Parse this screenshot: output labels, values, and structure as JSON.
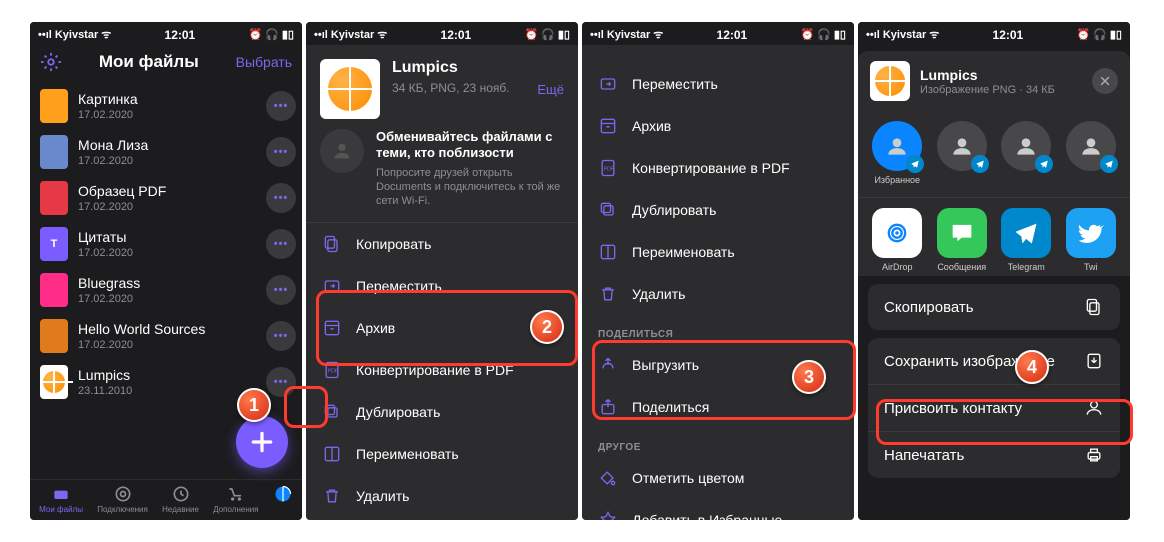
{
  "status": {
    "carrier": "Kyivstar",
    "time": "12:01"
  },
  "screen1": {
    "title": "Мои файлы",
    "select": "Выбрать",
    "files": [
      {
        "name": "Картинка",
        "date": "17.02.2020",
        "color": "#ff9f1c",
        "t": ""
      },
      {
        "name": "Мона Лиза",
        "date": "17.02.2020",
        "color": "#6a89cc",
        "t": ""
      },
      {
        "name": "Образец PDF",
        "date": "17.02.2020",
        "color": "#e63946",
        "t": ""
      },
      {
        "name": "Цитаты",
        "date": "17.02.2020",
        "color": "#7b5cff",
        "t": "T"
      },
      {
        "name": "Bluegrass",
        "date": "17.02.2020",
        "color": "#ff2d87",
        "t": ""
      },
      {
        "name": "Hello World Sources",
        "date": "17.02.2020",
        "color": "#e07a1a",
        "t": ""
      },
      {
        "name": "Lumpics",
        "date": "23.11.2010",
        "color": "#ffffff",
        "t": ""
      }
    ],
    "tabs": [
      "Мои файлы",
      "Подключения",
      "Недавние",
      "Дополнения",
      ""
    ]
  },
  "screen2": {
    "file_name": "Lumpics",
    "file_meta": "34 КБ, PNG, 23 нояб.",
    "more": "Ещё",
    "nearby_title": "Обменивайтесь файлами с теми, кто поблизости",
    "nearby_sub": "Попросите друзей открыть Documents и подключитесь к той же сети Wi-Fi.",
    "actions": [
      "Копировать",
      "Переместить",
      "Архив",
      "Конвертирование в PDF",
      "Дублировать",
      "Переименовать",
      "Удалить"
    ]
  },
  "screen3": {
    "actions_top": [
      "Переместить",
      "Архив",
      "Конвертирование в PDF",
      "Дублировать",
      "Переименовать",
      "Удалить"
    ],
    "share_header": "ПОДЕЛИТЬСЯ",
    "share_actions": [
      "Выгрузить",
      "Поделиться"
    ],
    "other_header": "ДРУГОЕ",
    "other_actions": [
      "Отметить цветом",
      "Добавить в Избранные"
    ]
  },
  "screen4": {
    "file_name": "Lumpics",
    "file_meta": "Изображение PNG · 34 КБ",
    "contacts": [
      "Избранное",
      "",
      "",
      ""
    ],
    "apps": [
      "AirDrop",
      "Сообщения",
      "Telegram",
      "Twi"
    ],
    "actions": [
      "Скопировать",
      "Сохранить изображение",
      "Присвоить контакту",
      "Напечатать"
    ]
  },
  "badges": [
    "1",
    "2",
    "3",
    "4"
  ]
}
